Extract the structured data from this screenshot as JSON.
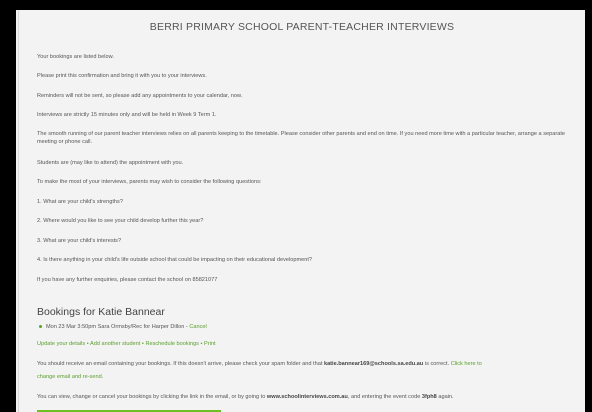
{
  "title": "BERRI PRIMARY SCHOOL PARENT-TEACHER INTERVIEWS",
  "paragraphs": {
    "p1": "Your bookings are listed below.",
    "p2": "Please print this confirmation and bring it with you to your interviews.",
    "p3": "Reminders will not be sent, so please add any appointments to your calendar, now.",
    "p4": "Interviews are strictly 15 minutes only and will be held in Week 9 Term 1.",
    "p5": "The smooth running of our parent teacher interviews relies on all parents keeping to the timetable. Please consider other parents and end on time. If you need more time with a particular teacher, arrange a separate meeting or phone call.",
    "p6": "Students are (may like to attend) the appointment with you.",
    "p7": "To make the most of your interviews, parents may wish to consider the following questions:",
    "q1": "1. What are your child's strengths?",
    "q2": "2. Where would you like to see your child develop further this year?",
    "q3": "3. What are your child's interests?",
    "q4": "4. Is there anything in your child's life outside school that could be impacting on their educational development?",
    "p8": "If you have any further enquiries, please contact the school on 85821077"
  },
  "bookings": {
    "heading": "Bookings for Katie Bannear",
    "item_text": "Mon 23 Mar 3:50pm Sara Ormsby/Rec for Harper Dillon -",
    "item_cancel": "Cancel",
    "links": {
      "update": "Update your details",
      "add": "Add another student",
      "reschedule": "Reschedule bookings",
      "print": "Print",
      "separator": " • "
    }
  },
  "email_note": {
    "text_a": "You should receive an email containing your bookings. If this doesn't arrive, please check your spam folder and that",
    "email": "katie.bannear169@schools.sa.edu.au",
    "text_b": "is correct.",
    "link": "Click here to change email and re-send.",
    "change_link_head": "Click here to",
    "change_link_tail": "change email and re-send."
  },
  "view_note": {
    "text_a": "You can view, change or cancel your bookings by clicking the link in the email, or by going to",
    "site": "www.schoolinterviews.com.au",
    "text_b": ", and entering the event code",
    "code": "3fph8",
    "text_c": "again."
  },
  "colors": {
    "accent_green": "#5aa02c",
    "button_green": "#6cc024",
    "text": "#555555"
  }
}
